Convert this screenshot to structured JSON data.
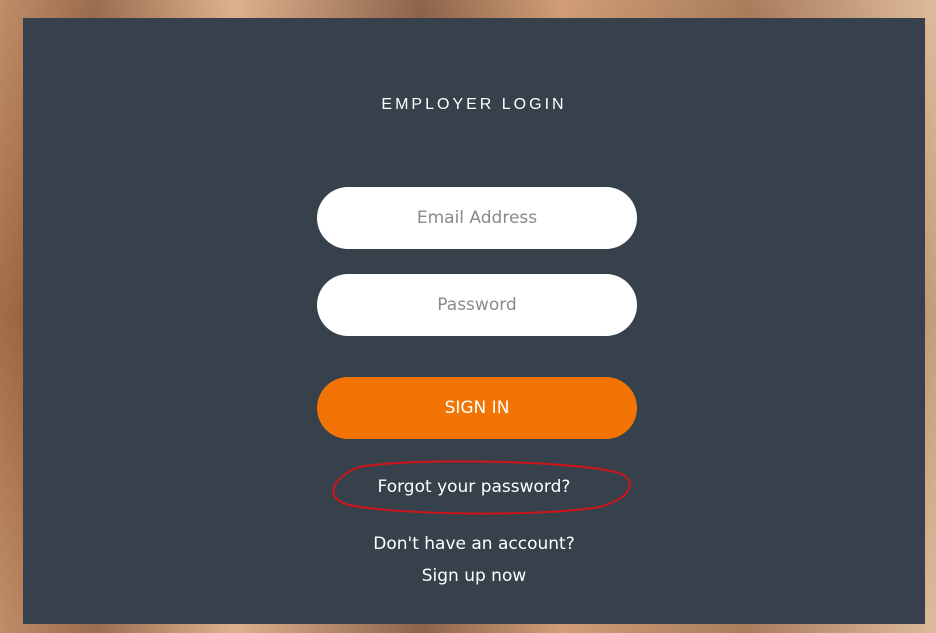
{
  "login": {
    "title": "EMPLOYER LOGIN",
    "email_placeholder": "Email Address",
    "password_placeholder": "Password",
    "signin_label": "SIGN IN",
    "forgot_label": "Forgot your password?",
    "no_account_label": "Don't have an account?",
    "signup_label": "Sign up now"
  },
  "colors": {
    "panel": "#37414c",
    "accent": "#f27405",
    "annotation": "#d0141c"
  }
}
